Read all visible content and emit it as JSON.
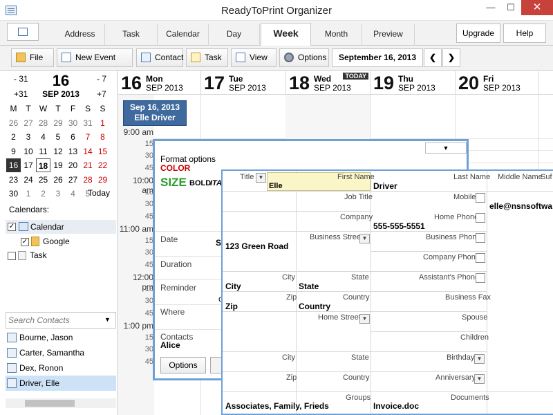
{
  "window": {
    "title": "ReadyToPrint Organizer",
    "min": "—",
    "max": "☐",
    "close": "✕"
  },
  "tabs": [
    "Address",
    "Task",
    "Calendar",
    "Day",
    "Week",
    "Month",
    "Preview"
  ],
  "active_tab": "Week",
  "side_buttons": {
    "upgrade": "Upgrade",
    "help": "Help"
  },
  "toolbar": {
    "file": "File",
    "new_event": "New Event",
    "contact": "Contact",
    "task": "Task",
    "view": "View",
    "options": "Options",
    "date": "September 16, 2013",
    "prev": "❮",
    "next": "❯"
  },
  "mini_nav": {
    "back31": "- 31",
    "back7": "- 7",
    "fwd31": "+31",
    "fwd7": "+7",
    "day": "16",
    "monthyear": "SEP 2013",
    "today": "Today"
  },
  "mini_weekdays": [
    "M",
    "T",
    "W",
    "T",
    "F",
    "S",
    "S"
  ],
  "mini_weeks": [
    [
      "26",
      "27",
      "28",
      "29",
      "30",
      "31",
      "1"
    ],
    [
      "2",
      "3",
      "4",
      "5",
      "6",
      "7",
      "8"
    ],
    [
      "9",
      "10",
      "11",
      "12",
      "13",
      "14",
      "15"
    ],
    [
      "16",
      "17",
      "18",
      "19",
      "20",
      "21",
      "22"
    ],
    [
      "23",
      "24",
      "25",
      "26",
      "27",
      "28",
      "29"
    ],
    [
      "30",
      "1",
      "2",
      "3",
      "4",
      "5",
      ""
    ]
  ],
  "calendars": {
    "heading": "Calendars:",
    "items": [
      {
        "label": "Calendar",
        "checked": true
      },
      {
        "label": "Google",
        "checked": true
      },
      {
        "label": "Task",
        "checked": false
      }
    ]
  },
  "search": {
    "placeholder": "Search Contacts"
  },
  "contacts": [
    "Bourne, Jason",
    "Carter, Samantha",
    "Dex, Ronon",
    "Driver, Elle"
  ],
  "days": [
    {
      "num": "16",
      "name": "Mon",
      "month": "SEP 2013"
    },
    {
      "num": "17",
      "name": "Tue",
      "month": "SEP 2013"
    },
    {
      "num": "18",
      "name": "Wed",
      "month": "SEP 2013",
      "badge": "TODAY"
    },
    {
      "num": "19",
      "name": "Thu",
      "month": "SEP 2013"
    },
    {
      "num": "20",
      "name": "Fri",
      "month": "SEP 2013"
    }
  ],
  "times": [
    "9:00 am",
    "15",
    "30",
    "45",
    "10:00 am",
    "15",
    "30",
    "45",
    "11:00 am",
    "15",
    "30",
    "45",
    "12:00 pm",
    "15",
    "30",
    "45",
    "1:00 pm",
    "15",
    "30",
    "45"
  ],
  "appointment": {
    "date": "Sep 16, 2013",
    "name": "Elle Driver"
  },
  "format_panel": {
    "title": "Format options",
    "color": "COLOR",
    "size": "SIZE",
    "bold": "BOLD",
    "italic": "ITA",
    "date": "Date",
    "date_val": "Se",
    "duration": "Duration",
    "reminder": "Reminder",
    "reminder_val": "c",
    "where": "Where",
    "contacts": "Contacts",
    "contacts_val": "Alice",
    "options_btn": "Options"
  },
  "card": {
    "title": "Title",
    "first_name": "First Name",
    "first_val": "Elle",
    "last_name": "Last Name",
    "last_val": "Driver",
    "middle_name": "Middle Name",
    "suffix": "Suf",
    "job_title": "Job Title",
    "mobile": "Mobile",
    "email_val": "elle@nsnsoftwa",
    "company": "Company",
    "home_phone": "Home Phone",
    "home_phone_val": "555-555-5551",
    "business_street": "Business Street",
    "business_street_val": "123 Green Road",
    "business_phone": "Business Phone",
    "city": "City",
    "state": "State",
    "city_val": "City",
    "state_val": "State",
    "company_phone": "Company Phone",
    "zip": "Zip",
    "country": "Country",
    "zip_val": "Zip",
    "country_val": "Country",
    "assistant_phone": "Assistant's Phone",
    "business_fax": "Business Fax",
    "home_street": "Home Street",
    "spouse": "Spouse",
    "children": "Children",
    "city2": "City",
    "state2": "State",
    "birthday": "Birthday",
    "zip2": "Zip",
    "country2": "Country",
    "anniversary": "Anniversary",
    "groups": "Groups",
    "groups_val": "Associates, Family, Frieds",
    "documents": "Documents",
    "documents_val": "Invoice.doc"
  }
}
